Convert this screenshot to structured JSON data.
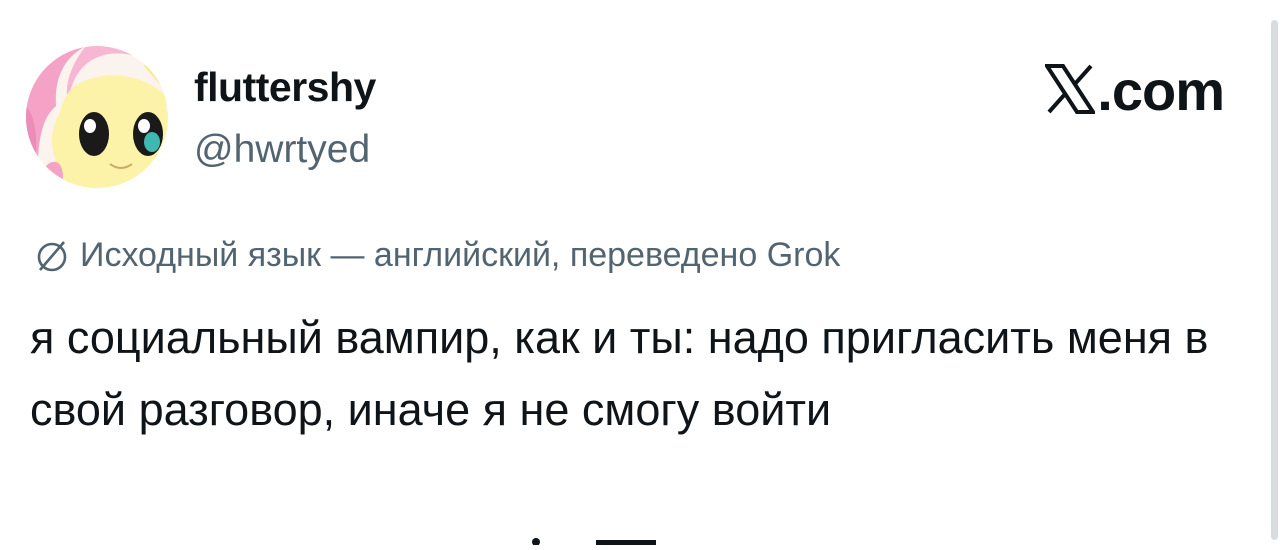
{
  "author": {
    "display_name": "fluttershy",
    "handle": "@hwrtyed",
    "avatar_icon": "fluttershy-pony-avatar"
  },
  "brand": {
    "label": ".com",
    "logo_icon": "x-logo-icon"
  },
  "translation": {
    "icon": "globe-translate-icon",
    "text": "Исходный язык — английский, переведено Grok"
  },
  "tweet": {
    "text": "я социальный вампир, как и ты: надо пригласить меня в свой разговор, иначе я не смогу войти"
  },
  "colors": {
    "text_primary": "#0f1419",
    "text_secondary": "#536471",
    "background": "#ffffff"
  }
}
